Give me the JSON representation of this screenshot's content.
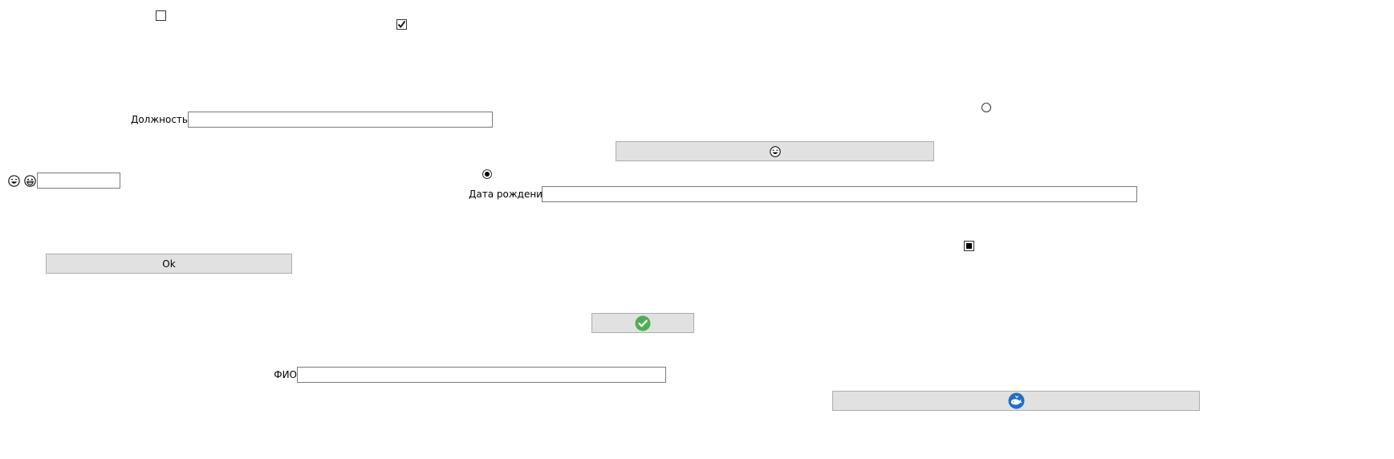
{
  "checkboxes": [
    {
      "id": "top-left",
      "state": "unchecked"
    },
    {
      "id": "top-center",
      "state": "checked"
    },
    {
      "id": "middle-right",
      "state": "indeterminate"
    }
  ],
  "radios": [
    {
      "id": "top-right",
      "selected": false
    },
    {
      "id": "center",
      "selected": true
    }
  ],
  "fields": {
    "position": {
      "label": "Должность",
      "value": ""
    },
    "birth_date": {
      "label": "Дата рождения",
      "value": ""
    },
    "fio": {
      "label": "ФИО",
      "value": ""
    },
    "emoji_field": {
      "value": ""
    }
  },
  "buttons": {
    "ok": {
      "label": "Ok"
    },
    "emoji_button": {
      "icon": "laughing-face-icon"
    },
    "check_button": {
      "icon": "green-check-circle-icon"
    },
    "whale_button": {
      "icon": "whale-icon"
    }
  },
  "icons": {
    "emoji_left_1": "laughing-face-icon",
    "emoji_left_2": "grinning-face-icon"
  },
  "colors": {
    "button_bg": "#e1e1e1",
    "button_border": "#adadad",
    "check_green": "#4caf50",
    "whale_blue": "#1e6fc9"
  }
}
